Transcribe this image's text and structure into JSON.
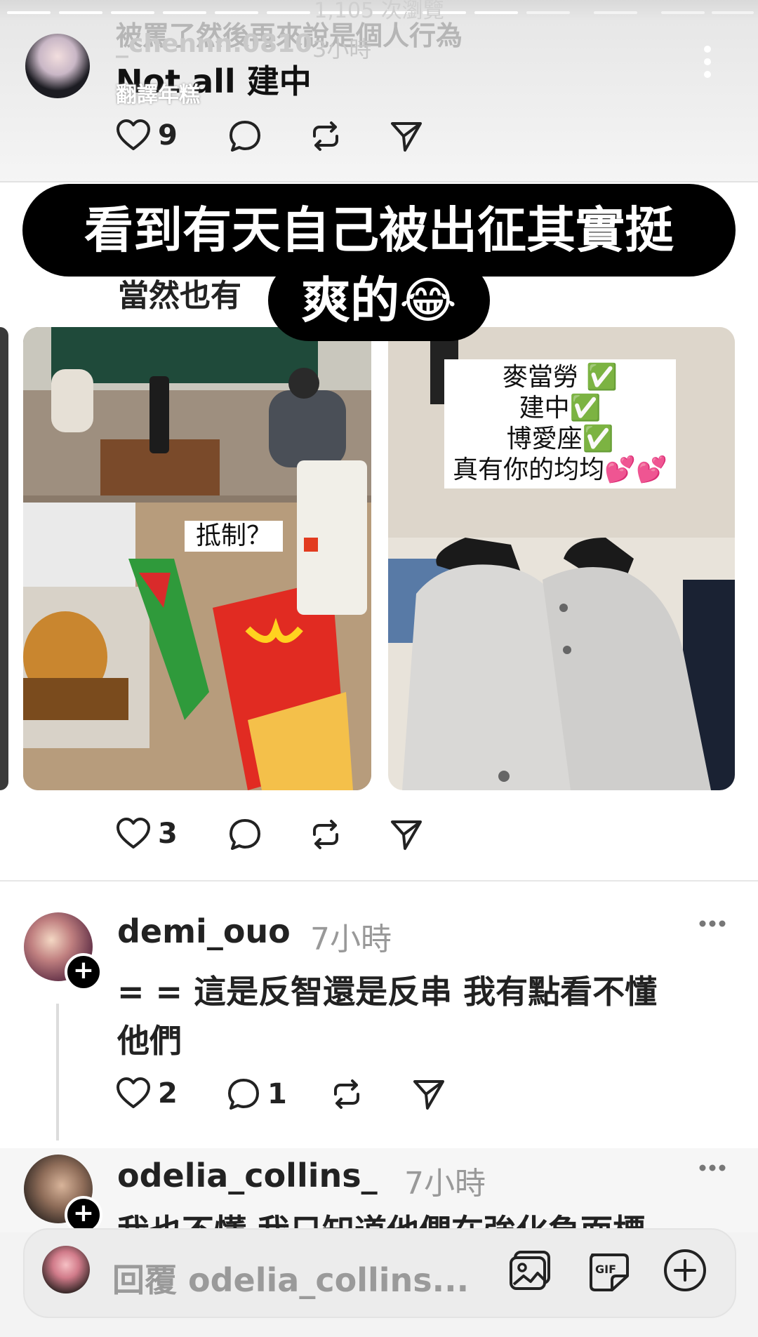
{
  "story": {
    "views": "1,105 次瀏覽",
    "progress_segments": 14,
    "active_segment": 10
  },
  "post1": {
    "username": "_chennn.0810",
    "time": "3小時",
    "clipped_text": "被罵了然後再來說是個人行為",
    "text": "Not all 建中",
    "translate_label": "翻譯年糕",
    "likes": "9"
  },
  "stickers": {
    "line1": "看到有天自己被出征其實挺",
    "line2": "爽的😂"
  },
  "post2": {
    "text_partial": "當然也有",
    "photo1_caption": "抵制？",
    "photo2_caption_lines": [
      "麥當勞 ✅",
      "建中✅",
      "博愛座✅",
      "真有你的均均💕💕"
    ],
    "likes": "3"
  },
  "comment1": {
    "username": "demi_ouo",
    "time": "7小時",
    "text_line1": "= = 這是反智還是反串 我有點看不懂",
    "text_line2": "他們",
    "likes": "2",
    "replies": "1"
  },
  "comment2": {
    "username": "odelia_collins_",
    "time": "7小時",
    "text_partial": "我也不懂 我只知道他們在強化負面標"
  },
  "reply": {
    "placeholder": "回覆 odelia_collins..."
  },
  "icons": {
    "like": "heart-icon",
    "comment": "comment-bubble-icon",
    "repost": "repost-icon",
    "share": "send-icon",
    "more": "more-dots-icon",
    "photo": "photo-icon",
    "gif": "gif-icon",
    "add": "add-circle-icon"
  }
}
